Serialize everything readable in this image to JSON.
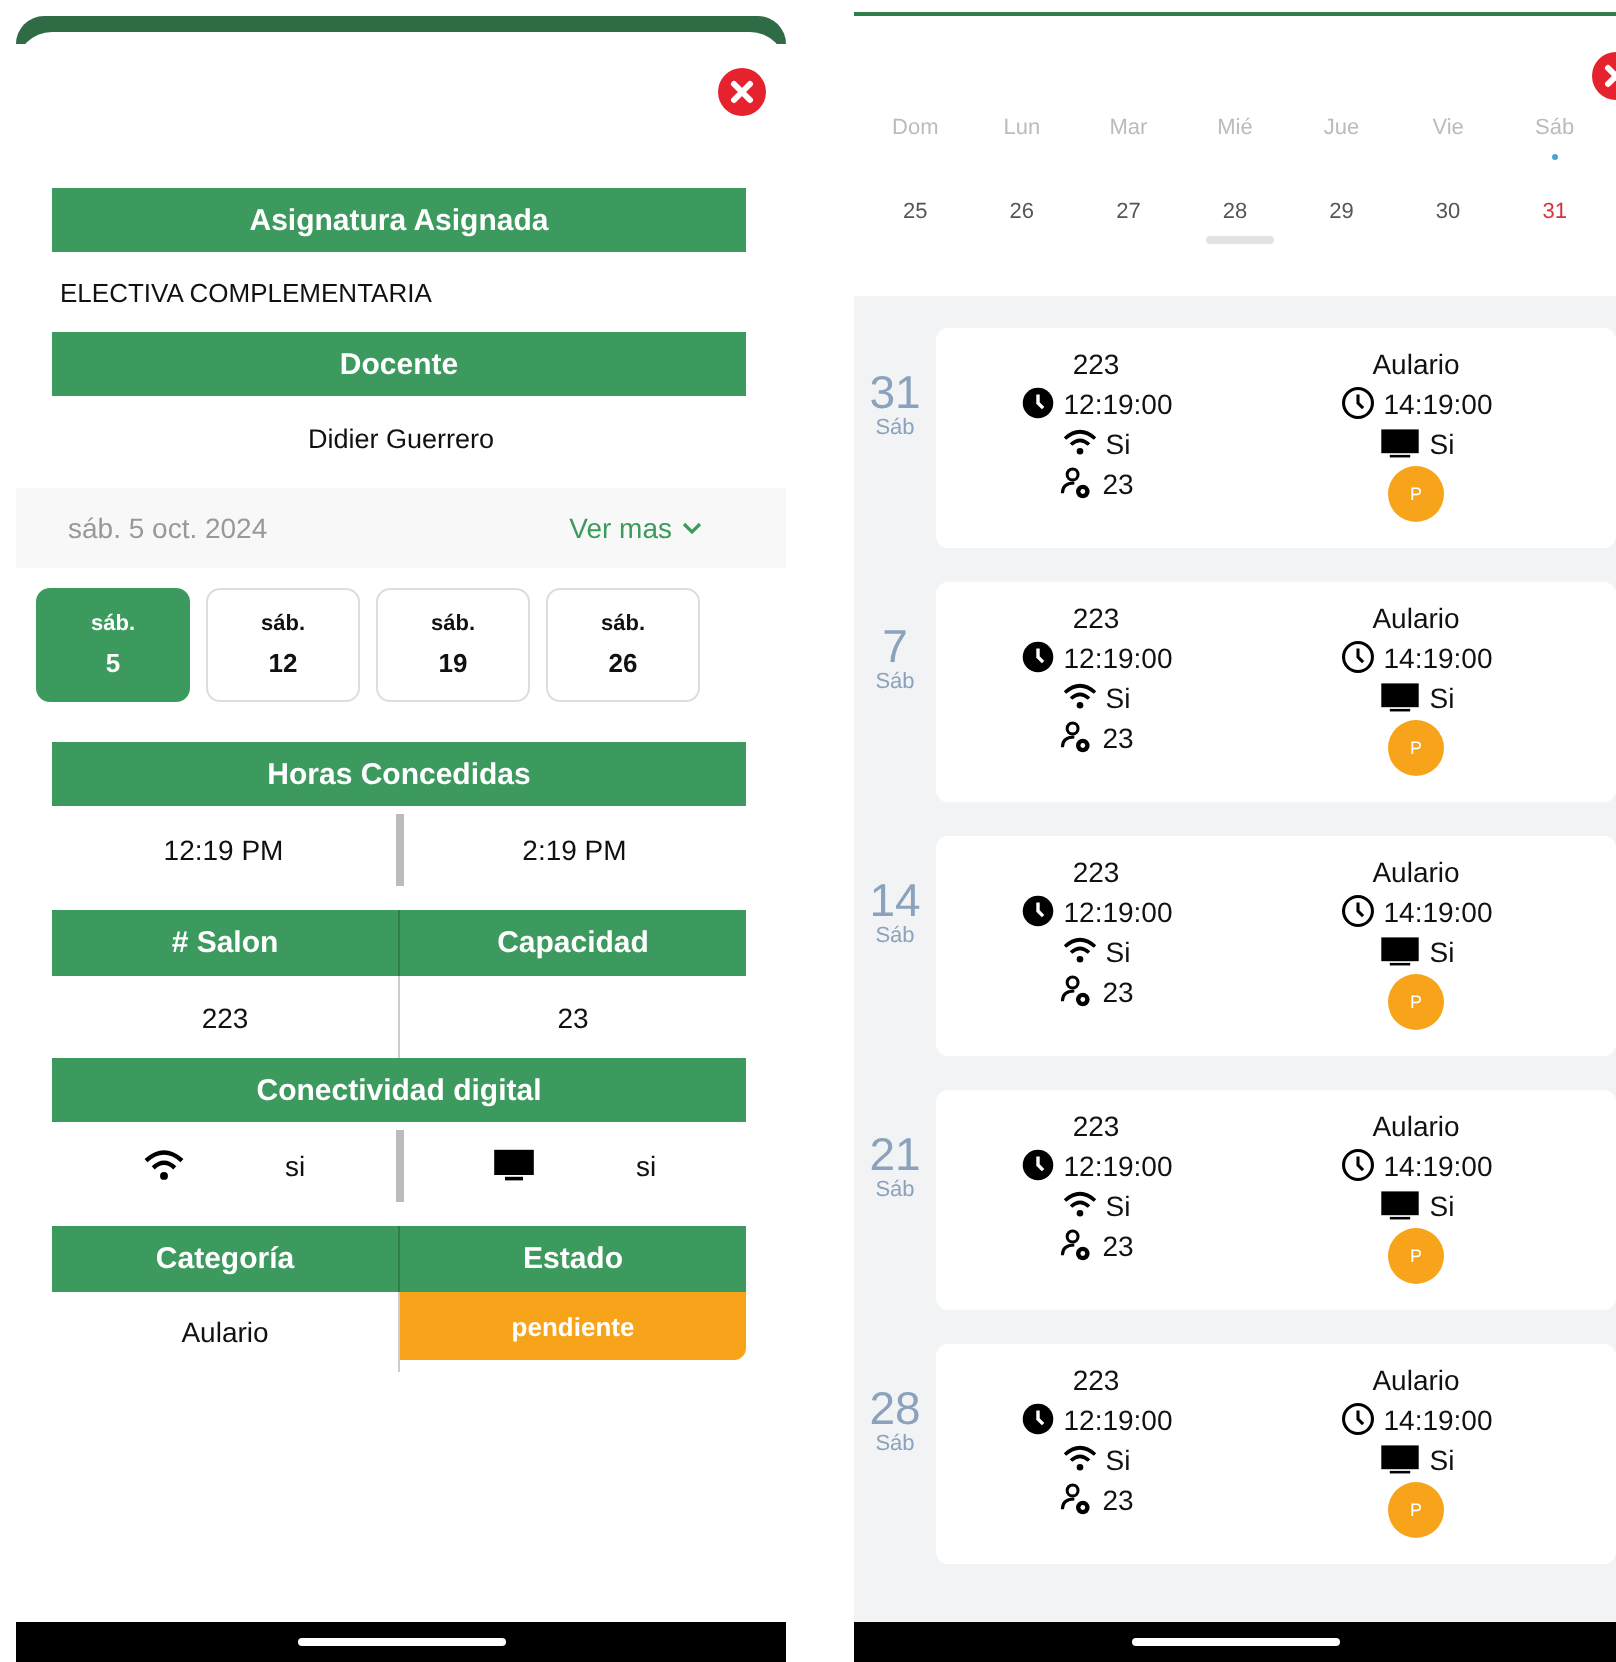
{
  "detail": {
    "subject_header": "Asignatura Asignada",
    "subject": "ELECTIVA COMPLEMENTARIA",
    "teacher_header": "Docente",
    "teacher": "Didier Guerrero",
    "date": "sáb. 5 oct. 2024",
    "more_link": "Ver mas",
    "days": [
      {
        "weekday": "sáb.",
        "day": "5",
        "selected": true
      },
      {
        "weekday": "sáb.",
        "day": "12",
        "selected": false
      },
      {
        "weekday": "sáb.",
        "day": "19",
        "selected": false
      },
      {
        "weekday": "sáb.",
        "day": "26",
        "selected": false
      }
    ],
    "hours_header": "Horas Concedidas",
    "start": "12:19 PM",
    "end": "2:19 PM",
    "room_header": "# Salon",
    "capacity_header": "Capacidad",
    "room": "223",
    "capacity": "23",
    "connectivity_header": "Conectividad digital",
    "wifi": "si",
    "screen": "si",
    "category_header": "Categoría",
    "status_header": "Estado",
    "category": "Aulario",
    "status": "pendiente"
  },
  "calendar": {
    "weekdays": [
      {
        "label": "Dom",
        "day": "25",
        "selected": false
      },
      {
        "label": "Lun",
        "day": "26",
        "selected": false
      },
      {
        "label": "Mar",
        "day": "27",
        "selected": false
      },
      {
        "label": "Mié",
        "day": "28",
        "selected": false
      },
      {
        "label": "Jue",
        "day": "29",
        "selected": false
      },
      {
        "label": "Vie",
        "day": "30",
        "selected": false
      },
      {
        "label": "Sáb",
        "day": "31",
        "selected": true
      }
    ],
    "sessions": [
      {
        "day": "31",
        "weekday": "Sáb",
        "room": "223",
        "start": "12:19:00",
        "wifi": "Si",
        "capacity": "23",
        "category": "Aulario",
        "end": "14:19:00",
        "screen": "Si",
        "status": "P"
      },
      {
        "day": "7",
        "weekday": "Sáb",
        "room": "223",
        "start": "12:19:00",
        "wifi": "Si",
        "capacity": "23",
        "category": "Aulario",
        "end": "14:19:00",
        "screen": "Si",
        "status": "P"
      },
      {
        "day": "14",
        "weekday": "Sáb",
        "room": "223",
        "start": "12:19:00",
        "wifi": "Si",
        "capacity": "23",
        "category": "Aulario",
        "end": "14:19:00",
        "screen": "Si",
        "status": "P"
      },
      {
        "day": "21",
        "weekday": "Sáb",
        "room": "223",
        "start": "12:19:00",
        "wifi": "Si",
        "capacity": "23",
        "category": "Aulario",
        "end": "14:19:00",
        "screen": "Si",
        "status": "P"
      },
      {
        "day": "28",
        "weekday": "Sáb",
        "room": "223",
        "start": "12:19:00",
        "wifi": "Si",
        "capacity": "23",
        "category": "Aulario",
        "end": "14:19:00",
        "screen": "Si",
        "status": "P"
      }
    ]
  }
}
